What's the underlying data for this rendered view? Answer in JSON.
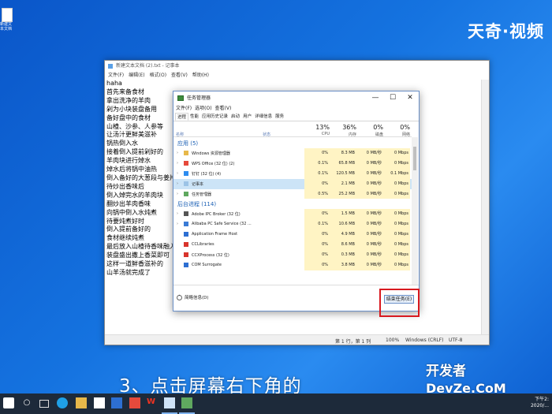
{
  "desktop": {
    "icon_label": "新建文\n本文档"
  },
  "watermark_top": "天奇·视频",
  "notepad": {
    "title": "新建文本文档 (2).txt - 记事本",
    "menu": [
      "文件(F)",
      "编辑(E)",
      "格式(O)",
      "查看(V)",
      "帮助(H)"
    ],
    "lines": [
      "haha",
      "首先来备食材",
      "拿出洗净的羊肉",
      "剁为小块装盘备用",
      "备好盘中的食材",
      "山楂、沙参、人参等",
      "让汤汁更鲜美滋补",
      "锅热倒入水",
      "接着倒入提前剁好的",
      "羊肉块进行焯水",
      "焯水后将锅中油热",
      "倒入备好的大葱段与姜片",
      "待炒出香味后",
      "倒入焯完水的羊肉块",
      "翻炒出羊肉香味",
      "向锅中倒入水炖煮",
      "待要炖煮好时",
      "倒入提前备好的",
      "食材继续炖煮",
      "最后放入山楂待香味融入后",
      "装盘盛出撒上香菜即可",
      "这样一道鲜香滋补的",
      "山羊汤就完成了"
    ],
    "status": {
      "position": "第 1 行，第 1 列",
      "zoom": "100%",
      "eol": "Windows (CRLF)",
      "encoding": "UTF-8"
    }
  },
  "task_manager": {
    "title": "任务管理器",
    "controls": {
      "minimize": "—",
      "maximize": "☐",
      "close": "✕"
    },
    "menu": [
      "文件(F)",
      "选项(O)",
      "查看(V)"
    ],
    "tabs": [
      "进程",
      "性能",
      "应用历史记录",
      "启动",
      "用户",
      "详细信息",
      "服务"
    ],
    "headers": {
      "name": "名称",
      "status": "状态",
      "cpu_pct": "13%",
      "cpu": "CPU",
      "mem_pct": "36%",
      "mem": "内存",
      "disk_pct": "0%",
      "disk": "磁盘",
      "net_pct": "0%",
      "net": "网络"
    },
    "apps_group": "应用 (5)",
    "apps": [
      {
        "name": "Windows 资源管理器",
        "cpu": "0%",
        "mem": "8.3 MB",
        "disk": "0 MB/秒",
        "net": "0 Mbps",
        "color": "#e7b84a"
      },
      {
        "name": "WPS Office (32 位) (2)",
        "cpu": "0.1%",
        "mem": "65.8 MB",
        "disk": "0 MB/秒",
        "net": "0 Mbps",
        "color": "#e64a3c"
      },
      {
        "name": "钉钉 (32 位) (4)",
        "cpu": "0.1%",
        "mem": "120.5 MB",
        "disk": "0 MB/秒",
        "net": "0.1 Mbps",
        "color": "#2d8cf0"
      },
      {
        "name": "记事本",
        "cpu": "0%",
        "mem": "2.1 MB",
        "disk": "0 MB/秒",
        "net": "0 Mbps",
        "color": "#9cc3e6"
      },
      {
        "name": "任务管理器",
        "cpu": "0.5%",
        "mem": "25.2 MB",
        "disk": "0 MB/秒",
        "net": "0 Mbps",
        "color": "#5fa85f"
      }
    ],
    "bg_group": "后台进程 (114)",
    "background": [
      {
        "name": "Adobe IPC Broker (32 位)",
        "cpu": "0%",
        "mem": "1.5 MB",
        "disk": "0 MB/秒",
        "net": "0 Mbps",
        "color": "#555555"
      },
      {
        "name": "Alibaba PC Safe Service (32 ...",
        "cpu": "0.1%",
        "mem": "10.6 MB",
        "disk": "0 MB/秒",
        "net": "0 Mbps",
        "color": "#3a7bd5"
      },
      {
        "name": "Application Frame Host",
        "cpu": "0%",
        "mem": "4.9 MB",
        "disk": "0 MB/秒",
        "net": "0 Mbps",
        "color": "#2d6fd2"
      },
      {
        "name": "CCLibraries",
        "cpu": "0%",
        "mem": "8.6 MB",
        "disk": "0 MB/秒",
        "net": "0 Mbps",
        "color": "#d8342c"
      },
      {
        "name": "CCXProcess (32 位)",
        "cpu": "0%",
        "mem": "0.3 MB",
        "disk": "0 MB/秒",
        "net": "0 Mbps",
        "color": "#d8342c"
      },
      {
        "name": "COM Surrogate",
        "cpu": "0%",
        "mem": "3.8 MB",
        "disk": "0 MB/秒",
        "net": "0 Mbps",
        "color": "#2d6fd2"
      }
    ],
    "fewer_details": "简略信息(D)",
    "end_task": "结束任务(E)"
  },
  "subtitle": "3、点击屏幕右下角的",
  "watermark_bottom": {
    "line1": "开发者",
    "line2": "DevZe.CoM"
  },
  "taskbar": {
    "clock": "下午2:\n2020/..."
  }
}
